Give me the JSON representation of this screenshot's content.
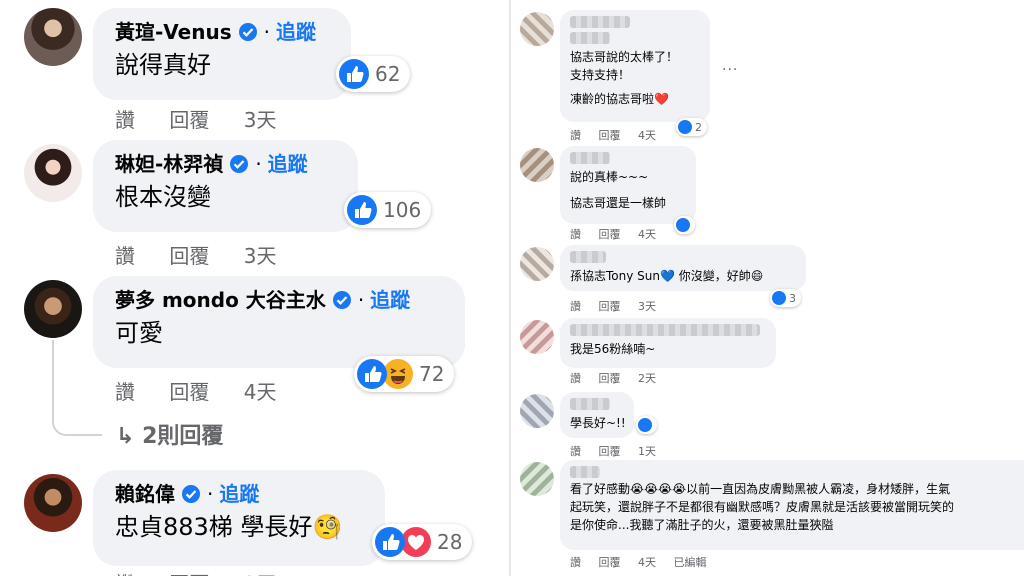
{
  "left": {
    "comments": [
      {
        "name": "黃瑄-Venus",
        "follow": "追蹤",
        "text": "說得真好",
        "reaction_count": "62",
        "reactions": [
          "like"
        ],
        "actions": [
          "讚",
          "回覆",
          "3天"
        ]
      },
      {
        "name": "琳妲-林羿禎",
        "follow": "追蹤",
        "text": "根本沒變",
        "reaction_count": "106",
        "reactions": [
          "like"
        ],
        "actions": [
          "讚",
          "回覆",
          "3天"
        ]
      },
      {
        "name": "夢多 mondo 大谷主水",
        "follow": "追蹤",
        "text": "可愛",
        "reaction_count": "72",
        "reactions": [
          "like",
          "haha"
        ],
        "actions": [
          "讚",
          "回覆",
          "4天"
        ],
        "replies_label": "2則回覆"
      },
      {
        "name": "賴銘偉",
        "follow": "追蹤",
        "text": "忠貞883梯 學長好",
        "text_emoji": "🧐",
        "reaction_count": "28",
        "reactions": [
          "like",
          "love"
        ],
        "actions": [
          "讚",
          "回覆",
          "3天"
        ]
      }
    ]
  },
  "right": {
    "comments": [
      {
        "lines": [
          "協志哥說的太棒了！",
          "支持支持！",
          "",
          "凍齡的協志哥啦❤️"
        ],
        "reaction_count": "2",
        "actions": [
          "讚",
          "回覆",
          "4天"
        ],
        "more": "..."
      },
      {
        "lines": [
          "說的真棒~~~",
          "",
          "協志哥還是一樣帥"
        ],
        "reaction_count": "",
        "actions": [
          "讚",
          "回覆",
          "4天"
        ]
      },
      {
        "lines": [
          "孫協志Tony Sun💙 你沒變，好帥😄"
        ],
        "reaction_count": "3",
        "actions": [
          "讚",
          "回覆",
          "3天"
        ]
      },
      {
        "lines": [
          "我是56粉絲喃~"
        ],
        "reaction_count": "",
        "actions": [
          "讚",
          "回覆",
          "2天"
        ]
      },
      {
        "lines": [
          "學長好~!!"
        ],
        "reaction_count": "",
        "actions": [
          "讚",
          "回覆",
          "1天"
        ]
      },
      {
        "lines": [
          "看了好感動😭😭😭😭以前一直因為皮膚黝黑被人霸凌，身材矮胖，生氣",
          "起玩笑，還說胖子不是都很有幽默感嗎？皮膚黑就是活該要被當開玩笑的",
          "是你使命...我聽了滿肚子的火，還要被黑肚量狹隘"
        ],
        "reaction_count": "",
        "actions": [
          "讚",
          "回覆",
          "4天",
          "已編輯"
        ]
      }
    ]
  },
  "colors": {
    "like": "#1877f2",
    "love": "#f33e58",
    "haha": "#f7b125",
    "link": "#1877f2",
    "bubble": "#f0f2f5",
    "meta": "#65676b"
  }
}
